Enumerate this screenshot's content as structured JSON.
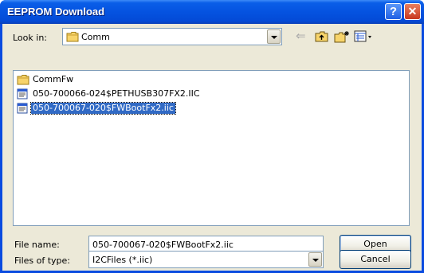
{
  "window": {
    "title": "EEPROM Download"
  },
  "lookin": {
    "label": "Look in:",
    "value": "Comm",
    "value_icon": "folder-icon"
  },
  "toolbar": {
    "icons": [
      "back-arrow-icon",
      "up-folder-icon",
      "new-folder-icon",
      "view-menu-icon"
    ]
  },
  "files": {
    "items": [
      {
        "name": "CommFw",
        "icon": "folder-icon"
      },
      {
        "name": "050-700066-024$PETHUSB307FX2.IIC",
        "icon": "file-icon"
      },
      {
        "name": "050-700067-020$FWBootFx2.iic",
        "icon": "file-icon",
        "selected": true
      }
    ]
  },
  "filename": {
    "label": "File name:",
    "value": "050-700067-020$FWBootFx2.iic"
  },
  "filetype": {
    "label": "Files of type:",
    "value": "I2CFiles (*.iic)"
  },
  "buttons": {
    "open": "Open",
    "cancel": "Cancel",
    "help": "?",
    "close": "✕"
  },
  "colors": {
    "titlebar": "#0553e0",
    "selection": "#316ac5",
    "dialog_face": "#ece9d8"
  }
}
